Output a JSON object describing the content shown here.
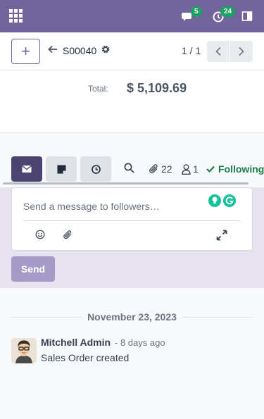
{
  "navbar": {
    "chat_badge": "5",
    "activity_badge": "24"
  },
  "control_panel": {
    "new_label": "+",
    "record_name": "S00040",
    "pager_value": "1 / 1"
  },
  "form": {
    "total_label": "Total:",
    "total_value": "$ 5,109.69"
  },
  "chatter": {
    "attachments_count": "22",
    "followers_count": "1",
    "follow_status": "Following",
    "composer": {
      "placeholder": "Send a message to followers…",
      "send_label": "Send"
    },
    "date_separator": "November 23, 2023",
    "messages": [
      {
        "author": "Mitchell Admin",
        "date": "- 8 days ago",
        "body": "Sales Order created"
      }
    ]
  },
  "colors": {
    "brand": "#71639e",
    "badge": "#1aa260",
    "following": "#1a7d47"
  },
  "icons": [
    "apps-icon",
    "chat-icon",
    "clock-icon",
    "panel-icon",
    "back-arrow-icon",
    "gear-icon",
    "chevron-left-icon",
    "chevron-right-icon",
    "envelope-icon",
    "note-icon",
    "clock-icon",
    "search-icon",
    "paperclip-icon",
    "user-icon",
    "check-icon",
    "smile-icon",
    "paperclip-icon",
    "expand-icon"
  ]
}
